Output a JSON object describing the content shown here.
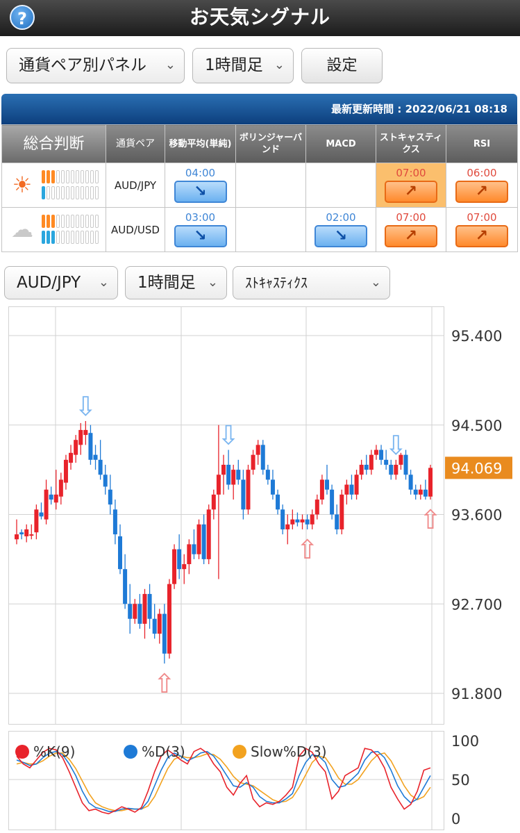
{
  "header": {
    "title": "お天気シグナル",
    "help_icon": "question-icon",
    "help_glyph": "?"
  },
  "toolbar": {
    "view_select": "通貨ペア別パネル",
    "timeframe_select": "1時間足",
    "settings_label": "設定"
  },
  "signal_panel": {
    "last_updated": "最新更新時間 : 2022/06/21 08:18",
    "columns": [
      "総合判断",
      "通貨ペア",
      "移動平均(単純)",
      "ボリンジャーバンド",
      "MACD",
      "ストキャスティクス",
      "RSI"
    ],
    "rows": [
      {
        "pair": "AUD/JPY",
        "weather": "sunny",
        "weather_glyph": "☀",
        "meter_top": 3,
        "meter_bottom": 1,
        "signals": [
          {
            "time": "04:00",
            "direction": "down",
            "glyph": "↘"
          },
          null,
          null,
          {
            "time": "07:00",
            "direction": "up",
            "glyph": "↗",
            "highlight": true
          },
          {
            "time": "06:00",
            "direction": "up",
            "glyph": "↗"
          }
        ]
      },
      {
        "pair": "AUD/USD",
        "weather": "cloudy",
        "weather_glyph": "☁",
        "meter_top": 3,
        "meter_bottom": 3,
        "signals": [
          {
            "time": "03:00",
            "direction": "down",
            "glyph": "↘"
          },
          null,
          {
            "time": "02:00",
            "direction": "down",
            "glyph": "↘"
          },
          {
            "time": "07:00",
            "direction": "up",
            "glyph": "↗"
          },
          {
            "time": "07:00",
            "direction": "up",
            "glyph": "↗"
          }
        ]
      }
    ]
  },
  "chart_controls": {
    "pair_select": "AUD/JPY",
    "timeframe_select": "1時間足",
    "indicator_select": "ｽﾄｷｬｽﾃｨｸｽ"
  },
  "colors": {
    "bull": "#e8232b",
    "bear": "#1e7ad6",
    "current_price_bg": "#e98b1f",
    "k_line": "#e8232b",
    "d_line": "#1e7ad6",
    "slowd_line": "#f2a21f"
  },
  "chart_data": [
    {
      "type": "candlestick",
      "y_ticks": [
        "95.400",
        "94.500",
        "93.600",
        "92.700",
        "91.800"
      ],
      "ylim": [
        91.8,
        95.4
      ],
      "current_price": "94.069",
      "current_price_value": 94.069,
      "ohlc": [
        [
          93.35,
          93.55,
          93.3,
          93.4
        ],
        [
          93.42,
          93.45,
          93.35,
          93.4
        ],
        [
          93.38,
          93.5,
          93.32,
          93.45
        ],
        [
          93.4,
          93.5,
          93.35,
          93.4
        ],
        [
          93.42,
          93.7,
          93.35,
          93.65
        ],
        [
          93.62,
          93.72,
          93.55,
          93.58
        ],
        [
          93.55,
          93.95,
          93.5,
          93.85
        ],
        [
          93.8,
          93.88,
          93.7,
          93.75
        ],
        [
          93.72,
          94.05,
          93.65,
          93.8
        ],
        [
          93.78,
          94.02,
          93.7,
          93.95
        ],
        [
          93.92,
          94.2,
          93.85,
          94.15
        ],
        [
          94.12,
          94.3,
          94.05,
          94.22
        ],
        [
          94.2,
          94.4,
          94.12,
          94.35
        ],
        [
          94.3,
          94.52,
          94.2,
          94.45
        ],
        [
          94.4,
          94.54,
          94.3,
          94.45
        ],
        [
          94.42,
          94.5,
          94.1,
          94.15
        ],
        [
          94.2,
          94.3,
          94.05,
          94.15
        ],
        [
          94.15,
          94.35,
          93.95,
          94.0
        ],
        [
          94.0,
          94.1,
          93.8,
          93.88
        ],
        [
          93.85,
          94.0,
          93.6,
          93.7
        ],
        [
          93.65,
          93.75,
          93.3,
          93.4
        ],
        [
          93.38,
          93.5,
          93.0,
          93.05
        ],
        [
          93.05,
          93.2,
          92.65,
          92.7
        ],
        [
          92.7,
          92.9,
          92.4,
          92.55
        ],
        [
          92.55,
          92.75,
          92.5,
          92.7
        ],
        [
          92.7,
          92.8,
          92.45,
          92.5
        ],
        [
          92.5,
          92.85,
          92.35,
          92.8
        ],
        [
          92.8,
          92.9,
          92.45,
          92.55
        ],
        [
          92.55,
          92.7,
          92.35,
          92.4
        ],
        [
          92.4,
          92.65,
          92.3,
          92.6
        ],
        [
          92.6,
          92.7,
          92.1,
          92.2
        ],
        [
          92.2,
          92.95,
          92.15,
          92.9
        ],
        [
          92.9,
          93.3,
          92.85,
          93.25
        ],
        [
          93.25,
          93.4,
          92.95,
          93.05
        ],
        [
          93.05,
          93.2,
          92.9,
          93.1
        ],
        [
          93.1,
          93.35,
          93.0,
          93.3
        ],
        [
          93.3,
          93.45,
          93.15,
          93.2
        ],
        [
          93.2,
          93.55,
          93.15,
          93.5
        ],
        [
          93.5,
          93.6,
          93.1,
          93.15
        ],
        [
          93.15,
          93.7,
          93.1,
          93.65
        ],
        [
          93.65,
          93.85,
          93.55,
          93.8
        ],
        [
          93.8,
          94.5,
          92.95,
          94.0
        ],
        [
          94.0,
          94.2,
          93.8,
          94.1
        ],
        [
          94.1,
          94.25,
          93.85,
          93.9
        ],
        [
          93.9,
          94.1,
          93.75,
          94.05
        ],
        [
          94.05,
          94.15,
          93.9,
          93.95
        ],
        [
          93.95,
          94.05,
          93.55,
          93.65
        ],
        [
          93.65,
          94.1,
          93.6,
          94.05
        ],
        [
          94.05,
          94.25,
          94.0,
          94.2
        ],
        [
          94.2,
          94.35,
          94.1,
          94.3
        ],
        [
          94.3,
          94.35,
          94.0,
          94.05
        ],
        [
          94.05,
          94.1,
          93.9,
          93.95
        ],
        [
          93.95,
          94.05,
          93.75,
          93.8
        ],
        [
          93.8,
          93.85,
          93.6,
          93.65
        ],
        [
          93.65,
          93.7,
          93.4,
          93.45
        ],
        [
          93.45,
          93.6,
          93.3,
          93.5
        ],
        [
          93.5,
          93.65,
          93.45,
          93.55
        ],
        [
          93.55,
          93.62,
          93.48,
          93.52
        ],
        [
          93.52,
          93.6,
          93.45,
          93.55
        ],
        [
          93.55,
          93.6,
          93.45,
          93.5
        ],
        [
          93.5,
          93.65,
          93.45,
          93.6
        ],
        [
          93.6,
          93.8,
          93.55,
          93.75
        ],
        [
          93.75,
          94.0,
          93.7,
          93.95
        ],
        [
          93.95,
          94.1,
          93.8,
          93.85
        ],
        [
          93.85,
          93.9,
          93.55,
          93.6
        ],
        [
          93.6,
          93.7,
          93.4,
          93.45
        ],
        [
          93.45,
          93.85,
          93.4,
          93.8
        ],
        [
          93.8,
          93.95,
          93.7,
          93.9
        ],
        [
          93.9,
          94.0,
          93.75,
          93.8
        ],
        [
          93.8,
          94.05,
          93.75,
          94.0
        ],
        [
          94.0,
          94.15,
          93.95,
          94.1
        ],
        [
          94.1,
          94.2,
          94.0,
          94.05
        ],
        [
          94.05,
          94.25,
          94.0,
          94.2
        ],
        [
          94.2,
          94.3,
          94.15,
          94.25
        ],
        [
          94.25,
          94.3,
          94.1,
          94.15
        ],
        [
          94.15,
          94.25,
          94.05,
          94.1
        ],
        [
          94.1,
          94.15,
          93.95,
          94.0
        ],
        [
          94.0,
          94.15,
          93.95,
          94.1
        ],
        [
          94.1,
          94.22,
          94.05,
          94.2
        ],
        [
          94.2,
          94.25,
          93.95,
          94.0
        ],
        [
          94.0,
          94.05,
          93.8,
          93.85
        ],
        [
          93.85,
          93.9,
          93.75,
          93.8
        ],
        [
          93.8,
          93.9,
          93.75,
          93.85
        ],
        [
          93.85,
          93.95,
          93.75,
          93.78
        ],
        [
          93.78,
          94.1,
          93.75,
          94.069
        ]
      ],
      "signal_arrows": [
        {
          "index": 14,
          "type": "sell",
          "glyph": "⇩"
        },
        {
          "index": 43,
          "type": "sell",
          "glyph": "⇩"
        },
        {
          "index": 77,
          "type": "sell",
          "glyph": "⇩"
        },
        {
          "index": 30,
          "type": "buy",
          "glyph": "⇧"
        },
        {
          "index": 59,
          "type": "buy",
          "glyph": "⇧"
        },
        {
          "index": 84,
          "type": "buy",
          "glyph": "⇧"
        }
      ]
    },
    {
      "type": "line",
      "y_ticks": [
        "100",
        "50",
        "0"
      ],
      "ylim": [
        0,
        100
      ],
      "series": [
        {
          "name": "%K(9)",
          "values": [
            80,
            70,
            65,
            75,
            85,
            90,
            88,
            78,
            60,
            40,
            20,
            10,
            12,
            8,
            6,
            10,
            15,
            12,
            8,
            14,
            35,
            60,
            80,
            88,
            82,
            75,
            70,
            86,
            90,
            84,
            70,
            60,
            40,
            30,
            45,
            55,
            25,
            15,
            20,
            18,
            22,
            30,
            40,
            80,
            90,
            85,
            70,
            60,
            25,
            35,
            55,
            60,
            65,
            90,
            88,
            80,
            65,
            40,
            25,
            12,
            18,
            35,
            62,
            65
          ]
        },
        {
          "name": "%D(3)",
          "values": [
            75,
            72,
            68,
            70,
            78,
            84,
            86,
            82,
            70,
            55,
            35,
            20,
            14,
            12,
            9,
            9,
            12,
            13,
            12,
            12,
            22,
            42,
            62,
            78,
            84,
            80,
            74,
            78,
            84,
            86,
            80,
            68,
            55,
            42,
            40,
            46,
            40,
            28,
            22,
            20,
            20,
            25,
            32,
            55,
            72,
            82,
            80,
            72,
            50,
            40,
            42,
            50,
            58,
            75,
            85,
            86,
            78,
            62,
            42,
            28,
            20,
            25,
            40,
            55
          ]
        },
        {
          "name": "Slow%D(3)",
          "values": [
            70,
            72,
            70,
            70,
            74,
            80,
            84,
            84,
            76,
            64,
            48,
            32,
            20,
            15,
            12,
            10,
            10,
            12,
            12,
            12,
            16,
            28,
            46,
            64,
            76,
            80,
            78,
            78,
            80,
            83,
            82,
            76,
            66,
            54,
            46,
            44,
            42,
            36,
            30,
            24,
            21,
            22,
            27,
            40,
            56,
            72,
            80,
            78,
            66,
            52,
            44,
            44,
            50,
            62,
            74,
            82,
            84,
            74,
            58,
            42,
            30,
            24,
            28,
            40
          ]
        }
      ]
    }
  ]
}
